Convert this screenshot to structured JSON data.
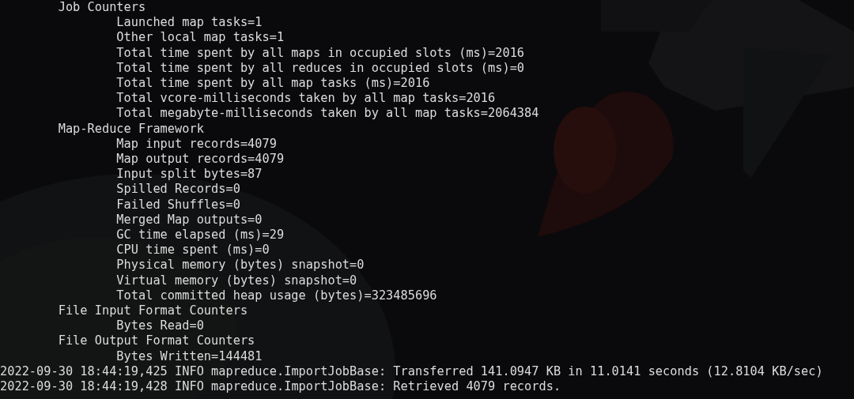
{
  "sections": [
    {
      "title": "Job Counters",
      "counters": [
        "Launched map tasks=1",
        "Other local map tasks=1",
        "Total time spent by all maps in occupied slots (ms)=2016",
        "Total time spent by all reduces in occupied slots (ms)=0",
        "Total time spent by all map tasks (ms)=2016",
        "Total vcore-milliseconds taken by all map tasks=2016",
        "Total megabyte-milliseconds taken by all map tasks=2064384"
      ]
    },
    {
      "title": "Map-Reduce Framework",
      "counters": [
        "Map input records=4079",
        "Map output records=4079",
        "Input split bytes=87",
        "Spilled Records=0",
        "Failed Shuffles=0",
        "Merged Map outputs=0",
        "GC time elapsed (ms)=29",
        "CPU time spent (ms)=0",
        "Physical memory (bytes) snapshot=0",
        "Virtual memory (bytes) snapshot=0",
        "Total committed heap usage (bytes)=323485696"
      ]
    },
    {
      "title": "File Input Format Counters",
      "counters": [
        "Bytes Read=0"
      ]
    },
    {
      "title": "File Output Format Counters",
      "counters": [
        "Bytes Written=144481"
      ]
    }
  ],
  "log_lines": [
    "2022-09-30 18:44:19,425 INFO mapreduce.ImportJobBase: Transferred 141.0947 KB in 11.0141 seconds (12.8104 KB/sec)",
    "2022-09-30 18:44:19,428 INFO mapreduce.ImportJobBase: Retrieved 4079 records."
  ]
}
